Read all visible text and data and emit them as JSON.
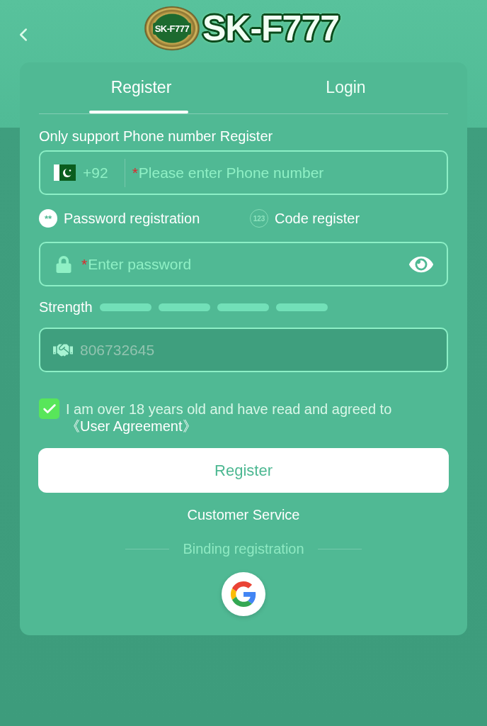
{
  "logo": {
    "badge_text": "SK-F777",
    "wordmark": "SK-F777"
  },
  "tabs": [
    {
      "label": "Register",
      "selected": true
    },
    {
      "label": "Login",
      "selected": false
    }
  ],
  "notice": "Only support Phone number Register",
  "phone_field": {
    "country_code": "+92",
    "required_mark": "*",
    "placeholder": "Please enter Phone number"
  },
  "registration_modes": [
    {
      "icon_text": "**",
      "label": "Password registration",
      "selected": true
    },
    {
      "icon_text": "123",
      "label": "Code register",
      "selected": false
    }
  ],
  "password_field": {
    "required_mark": "*",
    "placeholder": "Enter password"
  },
  "strength": {
    "label": "Strength",
    "segments": [
      {
        "filled": false
      },
      {
        "filled": false
      },
      {
        "filled": false
      },
      {
        "filled": false
      }
    ]
  },
  "invite_field": {
    "value": "806732645",
    "disabled": true
  },
  "agreement": {
    "checked": true,
    "text": "I am over 18 years old and have read and agreed to",
    "link": "《User Agreement》"
  },
  "register_button": "Register",
  "customer_service": "Customer Service",
  "binding": {
    "label": "Binding registration"
  }
}
